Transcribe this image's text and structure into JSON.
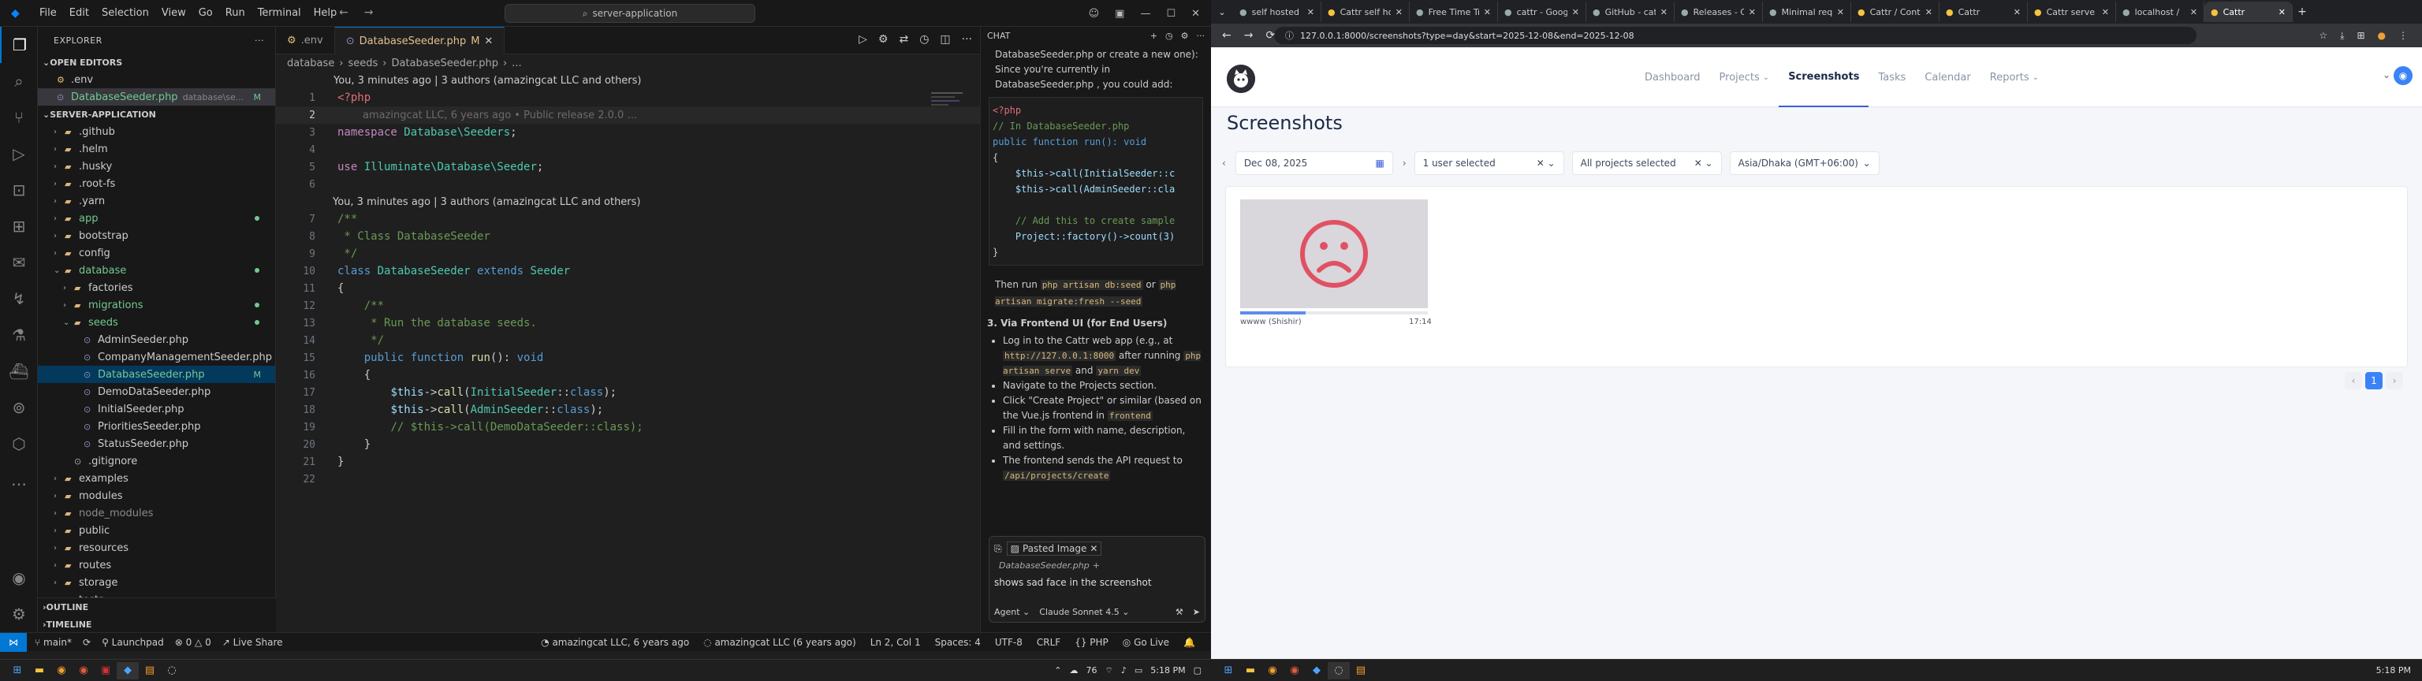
{
  "vscode": {
    "menu": [
      "File",
      "Edit",
      "Selection",
      "View",
      "Go",
      "Run",
      "Terminal",
      "Help"
    ],
    "search_box": "server-application",
    "explorer": {
      "title": "EXPLORER",
      "open_editors_label": "OPEN EDITORS",
      "open_editors": [
        {
          "name": ".env",
          "detail": ""
        },
        {
          "name": "DatabaseSeeder.php",
          "detail": "database\\se...",
          "badge": "M"
        }
      ],
      "project_label": "SERVER-APPLICATION",
      "tree": [
        {
          "name": ".github",
          "depth": 1,
          "type": "folder"
        },
        {
          "name": ".helm",
          "depth": 1,
          "type": "folder"
        },
        {
          "name": ".husky",
          "depth": 1,
          "type": "folder"
        },
        {
          "name": ".root-fs",
          "depth": 1,
          "type": "folder"
        },
        {
          "name": ".yarn",
          "depth": 1,
          "type": "folder"
        },
        {
          "name": "app",
          "depth": 1,
          "type": "folder",
          "color": "#73c991",
          "dot": true
        },
        {
          "name": "bootstrap",
          "depth": 1,
          "type": "folder"
        },
        {
          "name": "config",
          "depth": 1,
          "type": "folder"
        },
        {
          "name": "database",
          "depth": 1,
          "type": "folder-open",
          "color": "#73c991",
          "dot": true
        },
        {
          "name": "factories",
          "depth": 2,
          "type": "folder"
        },
        {
          "name": "migrations",
          "depth": 2,
          "type": "folder",
          "color": "#73c991",
          "dot": true
        },
        {
          "name": "seeds",
          "depth": 2,
          "type": "folder-open",
          "color": "#73c991",
          "dot": true
        },
        {
          "name": "AdminSeeder.php",
          "depth": 3,
          "type": "file"
        },
        {
          "name": "CompanyManagementSeeder.php",
          "depth": 3,
          "type": "file"
        },
        {
          "name": "DatabaseSeeder.php",
          "depth": 3,
          "type": "file",
          "color": "#73c991",
          "badge": "M",
          "selected": true
        },
        {
          "name": "DemoDataSeeder.php",
          "depth": 3,
          "type": "file"
        },
        {
          "name": "InitialSeeder.php",
          "depth": 3,
          "type": "file"
        },
        {
          "name": "PrioritiesSeeder.php",
          "depth": 3,
          "type": "file"
        },
        {
          "name": "StatusSeeder.php",
          "depth": 3,
          "type": "file"
        },
        {
          "name": ".gitignore",
          "depth": 2,
          "type": "file"
        },
        {
          "name": "examples",
          "depth": 1,
          "type": "folder"
        },
        {
          "name": "modules",
          "depth": 1,
          "type": "folder"
        },
        {
          "name": "node_modules",
          "depth": 1,
          "type": "folder",
          "color": "#8b8b8b"
        },
        {
          "name": "public",
          "depth": 1,
          "type": "folder"
        },
        {
          "name": "resources",
          "depth": 1,
          "type": "folder"
        },
        {
          "name": "routes",
          "depth": 1,
          "type": "folder"
        },
        {
          "name": "storage",
          "depth": 1,
          "type": "folder"
        },
        {
          "name": "tests",
          "depth": 1,
          "type": "folder"
        }
      ],
      "outline_label": "OUTLINE",
      "timeline_label": "TIMELINE"
    },
    "tabs": [
      {
        "name": ".env",
        "active": false
      },
      {
        "name": "DatabaseSeeder.php",
        "badge": "M",
        "active": true
      }
    ],
    "breadcrumb": [
      "database",
      "seeds",
      "DatabaseSeeder.php",
      "..."
    ],
    "blame1": "You, 3 minutes ago | 3 authors (amazingcat LLC and others)",
    "blame2": "You, 3 minutes ago | 3 authors (amazingcat LLC and others)",
    "ghost_blame": "amazingcat LLC, 6 years ago • Public release 2.0.0 …",
    "code": [
      {
        "n": "1",
        "html": "<span class='php'>&lt;?php</span>"
      },
      {
        "n": "2",
        "html": "",
        "ghost": true
      },
      {
        "n": "3",
        "html": "<span class='kw2'>namespace</span> <span class='cls'>Database\\Seeders</span>;"
      },
      {
        "n": "4",
        "html": ""
      },
      {
        "n": "5",
        "html": "<span class='kw2'>use</span> <span class='cls'>Illuminate\\Database\\Seeder</span>;"
      },
      {
        "n": "6",
        "html": ""
      },
      {
        "n": "7",
        "html": "<span class='cm'>/**</span>",
        "blame": true
      },
      {
        "n": "8",
        "html": "<span class='cm'> * Class DatabaseSeeder</span>"
      },
      {
        "n": "9",
        "html": "<span class='cm'> */</span>"
      },
      {
        "n": "10",
        "html": "<span class='kw'>class</span> <span class='cls'>DatabaseSeeder</span> <span class='kw'>extends</span> <span class='cls'>Seeder</span>"
      },
      {
        "n": "11",
        "html": "{"
      },
      {
        "n": "12",
        "html": "    <span class='cm'>/**</span>"
      },
      {
        "n": "13",
        "html": "<span class='cm'>     * Run the database seeds.</span>"
      },
      {
        "n": "14",
        "html": "<span class='cm'>     */</span>"
      },
      {
        "n": "15",
        "html": "    <span class='kw'>public</span> <span class='kw'>function</span> <span class='fn'>run</span>(): <span class='kw'>void</span>"
      },
      {
        "n": "16",
        "html": "    {"
      },
      {
        "n": "17",
        "html": "        <span style='color:#9cdcfe'>$this</span>-&gt;<span class='fn'>call</span>(<span class='cls'>InitialSeeder</span>::<span class='kw'>class</span>);"
      },
      {
        "n": "18",
        "html": "        <span style='color:#9cdcfe'>$this</span>-&gt;<span class='fn'>call</span>(<span class='cls'>AdminSeeder</span>::<span class='kw'>class</span>);"
      },
      {
        "n": "19",
        "html": "        <span class='cm'>// $this-&gt;call(DemoDataSeeder::class);</span>"
      },
      {
        "n": "20",
        "html": "    }"
      },
      {
        "n": "21",
        "html": "}"
      },
      {
        "n": "22",
        "html": ""
      }
    ],
    "chat": {
      "title": "CHAT",
      "intro_1": "DatabaseSeeder.php  or create a new one):",
      "intro_2": "Since you're currently in",
      "intro_3": "DatabaseSeeder.php , you could add:",
      "code_lines": [
        "<?php",
        "// In DatabaseSeeder.php",
        "public function run(): void",
        "{",
        "    $this->call(InitialSeeder::c",
        "    $this->call(AdminSeeder::cla",
        "",
        "    // Add this to create sample",
        "    Project::factory()->count(3)",
        "}"
      ],
      "then_run_1": "Then run",
      "cmd_1": "php artisan db:seed",
      "or": "or",
      "cmd_2": "php artisan migrate:fresh --seed",
      "section_title": "3. Via Frontend UI (for End Users)",
      "bullets": [
        "Log in to the Cattr web app (e.g., at",
        "http://127.0.0.1:8000",
        "after running",
        "php artisan serve",
        "and",
        "yarn dev",
        "Navigate to the Projects section.",
        "Click \"Create Project\" or similar (based on the Vue.js frontend in",
        "frontend",
        "Fill in the form with name, description, and settings.",
        "The frontend sends the API request to",
        "/api/projects/create"
      ],
      "attachment": "Pasted Image",
      "context_file": "DatabaseSeeder.php",
      "input_text": "shows sad face in the screenshot",
      "mode": "Agent",
      "model": "Claude Sonnet 4.5"
    },
    "status": {
      "branch": "main*",
      "launchpad": "Launchpad",
      "problems": "0",
      "warnings": "0",
      "liveshare": "Live Share",
      "blame": "amazingcat LLC, 6 years ago",
      "blame2": "amazingcat LLC (6 years ago)",
      "cursor": "Ln 2, Col 1",
      "spaces": "Spaces: 4",
      "encoding": "UTF-8",
      "eol": "CRLF",
      "lang": "PHP",
      "golive": "Go Live"
    }
  },
  "browser": {
    "tabs": [
      "self hosted",
      "Cattr self hos",
      "Free Time Tr",
      "cattr - Goog",
      "GitHub - catt",
      "Releases - C",
      "Minimal requ",
      "Cattr / Cont",
      "Cattr",
      "Cattr serve",
      "localhost /",
      "Cattr"
    ],
    "active_tab": 11,
    "url": "127.0.0.1:8000/screenshots?type=day&start=2025-12-08&end=2025-12-08",
    "nav": [
      "Dashboard",
      "Projects",
      "Screenshots",
      "Tasks",
      "Calendar",
      "Reports"
    ],
    "nav_active": 2,
    "page_title": "Screenshots",
    "filters": {
      "date": "Dec 08, 2025",
      "users": "1 user selected",
      "projects": "All projects selected",
      "timezone": "Asia/Dhaka (GMT+06:00)"
    },
    "shot": {
      "user": "wwww (Shishir)",
      "time": "17:14",
      "progress": 0.35
    },
    "pagination_current": "1"
  },
  "taskbar": {
    "time_left": "5:18 PM",
    "time_right": "5:18 PM",
    "temp": "76"
  },
  "colors": {
    "vs_bg": "#1f1f1f",
    "accent": "#0078d4",
    "git_modified": "#73c991",
    "app_accent": "#3b5bdb",
    "sad_face": "#e05263"
  }
}
